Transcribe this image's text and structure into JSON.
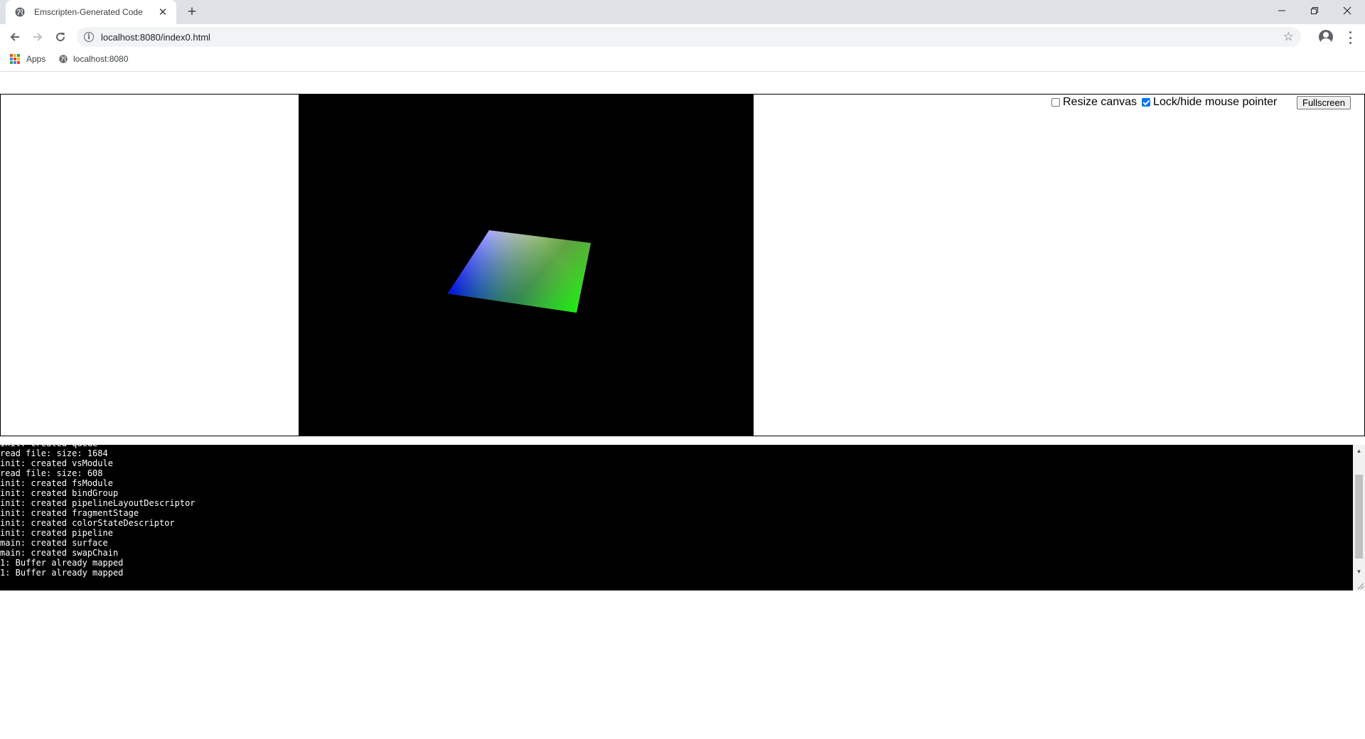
{
  "browser": {
    "tab_title": "Emscripten-Generated Code",
    "new_tab_symbol": "+",
    "close_symbol": "✕",
    "url": "localhost:8080/index0.html",
    "bookmarks": [
      {
        "label": "Apps",
        "icon": "apps-grid-icon"
      },
      {
        "label": "localhost:8080",
        "icon": "globe-icon"
      }
    ],
    "window_controls": [
      "minimize-icon",
      "restore-icon",
      "close-icon"
    ]
  },
  "page": {
    "controls": {
      "resize_canvas_label": "Resize canvas",
      "resize_canvas_checked": false,
      "lock_pointer_label": "Lock/hide mouse pointer",
      "lock_pointer_checked": true,
      "fullscreen_label": "Fullscreen"
    },
    "canvas": {
      "background": "#000000",
      "quad_colors": [
        "#ffffff",
        "#ff0000",
        "#00ff00",
        "#0000ff"
      ]
    },
    "console_lines": [
      "init: created queue",
      "read file: size: 1684",
      "init: created vsModule",
      "read file: size: 608",
      "init: created fsModule",
      "init: created bindGroup",
      "init: created pipelineLayoutDescriptor",
      "init: created fragmentStage",
      "init: created colorStateDescriptor",
      "init: created pipeline",
      "main: created surface",
      "main: created swapChain",
      "1: Buffer already mapped",
      "1: Buffer already mapped"
    ]
  }
}
